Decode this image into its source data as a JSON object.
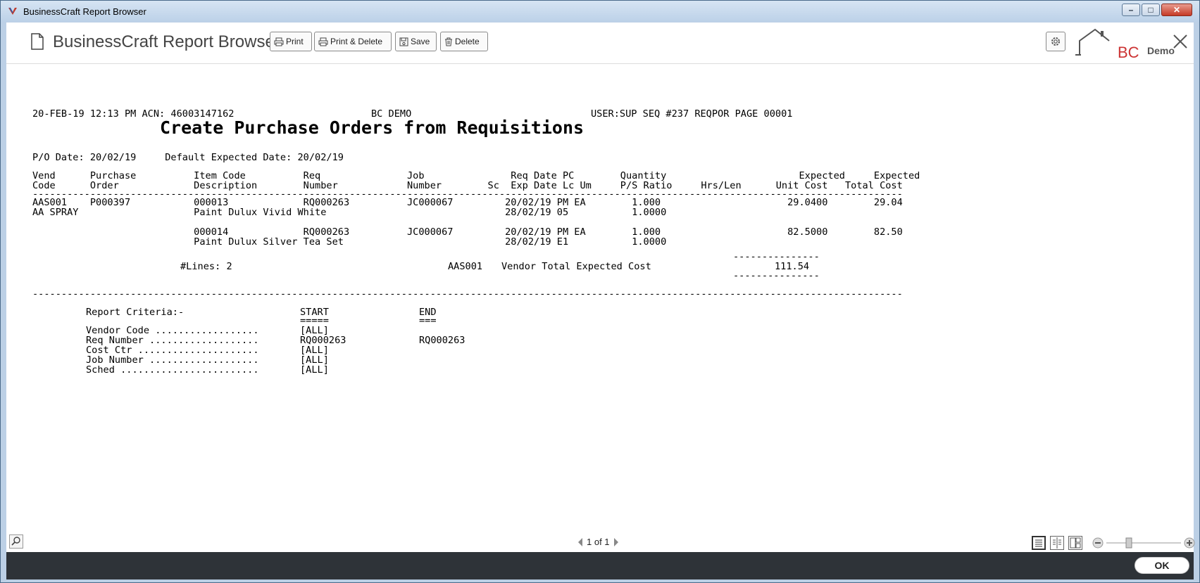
{
  "window": {
    "title": "BusinessCraft Report Browser",
    "minimize_glyph": "–",
    "maximize_glyph": "□",
    "close_glyph": "✕"
  },
  "toolbar": {
    "app_title": "BusinessCraft Report Browser",
    "print_label": "Print",
    "print_delete_label": "Print & Delete",
    "save_label": "Save",
    "delete_label": "Delete",
    "logo_text": "BC",
    "demo_label": "Demo"
  },
  "report": {
    "header_left": "20-FEB-19 12:13 PM ACN: 46003147162",
    "header_center": "BC DEMO",
    "header_right": "USER:SUP SEQ #237 REQPOR PAGE 00001",
    "title": "Create Purchase Orders from Requisitions",
    "po_date_line": "P/O Date: 20/02/19     Default Expected Date: 20/02/19",
    "col_header_1": "Vend      Purchase          Item Code          Req               Job               Req Date PC        Quantity                       Expected     Expected",
    "col_header_2": "Code      Order             Description        Number            Number        Sc  Exp Date Lc Um     P/S Ratio     Hrs/Len      Unit Cost   Total Cost",
    "divider": "-------------------------------------------------------------------------------------------------------------------------------------------------------",
    "rows": [
      "AAS001    P000397           000013             RQ000263          JC000067         20/02/19 PM EA        1.000                      29.0400        29.04",
      "AA SPRAY                    Paint Dulux Vivid White                               28/02/19 05           1.0000",
      "",
      "                            000014             RQ000263          JC000067         20/02/19 PM EA        1.000                      82.5000        82.50",
      "                            Paint Dulux Silver Tea Set                            28/02/19 E1           1.0000"
    ],
    "total_rule": "---------------",
    "lines_label": "#Lines: 2",
    "vendor_code": "AAS001",
    "vendor_total_label": "Vendor Total Expected Cost",
    "vendor_total_value": "111.54",
    "criteria_heading": "Report Criteria:-",
    "start_heading": "START",
    "start_underline": "=====",
    "end_heading": "END",
    "end_underline": "===",
    "criteria": [
      {
        "label": "Vendor Code ..................",
        "start": "[ALL]",
        "end": ""
      },
      {
        "label": "Req Number ...................",
        "start": "RQ000263",
        "end": "RQ000263"
      },
      {
        "label": "Cost Ctr .....................",
        "start": "[ALL]",
        "end": ""
      },
      {
        "label": "Job Number ...................",
        "start": "[ALL]",
        "end": ""
      },
      {
        "label": "Sched ........................",
        "start": "[ALL]",
        "end": ""
      }
    ]
  },
  "pager": {
    "text": "1 of 1"
  },
  "footer": {
    "ok_label": "OK"
  },
  "icons": [
    "app-icon",
    "document-icon",
    "printer-icon",
    "floppy-icon",
    "trash-icon",
    "gear-icon",
    "house-logo-icon",
    "close-icon",
    "search-icon",
    "single-page-icon",
    "two-page-icon",
    "multi-page-icon",
    "zoom-out-icon",
    "zoom-in-icon"
  ]
}
